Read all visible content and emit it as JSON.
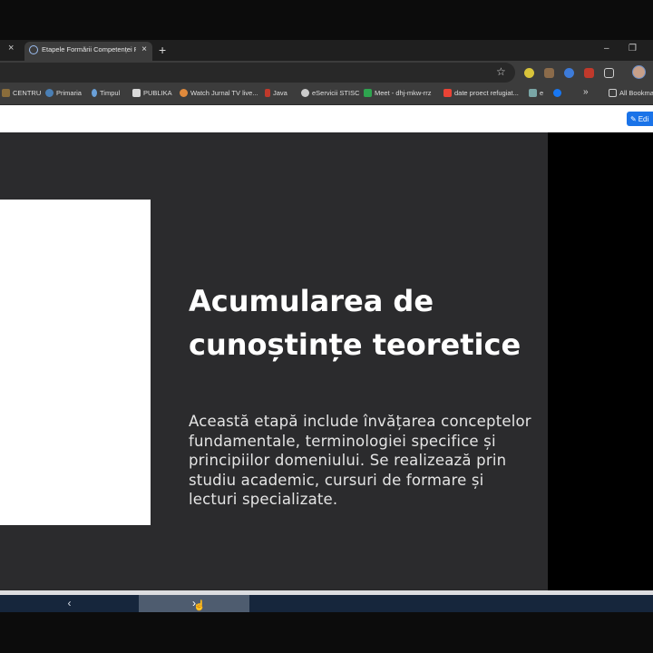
{
  "browser": {
    "active_tab_title": "Etapele Formării Competenței P",
    "close_glyph": "×",
    "new_tab_glyph": "+",
    "window_controls": [
      "–",
      "❐",
      "×"
    ],
    "bookmarks": [
      {
        "label": "CENTRU",
        "icon": "bookmark-folder-icon",
        "color": "#8a6d3b"
      },
      {
        "label": "Primaria",
        "icon": "wordpress-icon",
        "color": "#4a7fb5"
      },
      {
        "label": "Timpul",
        "icon": "timpul-icon",
        "color": "#6aa0d8"
      },
      {
        "label": "PUBLIKA",
        "icon": "publika-icon",
        "color": "#d9d9d9"
      },
      {
        "label": "Watch Jurnal TV live...",
        "icon": "jurnal-tv-icon",
        "color": "#e08a3c"
      },
      {
        "label": "Java",
        "icon": "java-icon",
        "color": "#c0392b"
      },
      {
        "label": "eServicii STISC",
        "icon": "eservicii-icon",
        "color": "#cccccc"
      },
      {
        "label": "Meet - dhj-mkw-rrz",
        "icon": "google-meet-icon",
        "color": "#2ea44f"
      },
      {
        "label": "date proect refugiat...",
        "icon": "gmail-icon",
        "color": "#ea4335"
      },
      {
        "label": "e",
        "icon": "bookmark-e-icon",
        "color": "#7aa6a6"
      },
      {
        "label": "",
        "icon": "facebook-icon",
        "color": "#1877f2"
      }
    ],
    "more_glyph": "»",
    "all_bookmarks_label": "All Bookma"
  },
  "page": {
    "edit_button_label": "Edi",
    "slide_title": "Acumularea de cunoștințe teoretice",
    "slide_body": "Această etapă include învățarea conceptelor fundamentale, terminologiei specifice și principiilor domeniului. Se realizează prin studiu academic, cursuri de formare și lecturi specializate.",
    "nav_prev_glyph": "‹",
    "nav_next_glyph": "›"
  },
  "colors": {
    "slide_bg": "#2b2b2d",
    "nav_bg": "#16263c",
    "nav_active": "#4e5c6f",
    "edit_button": "#1a73e8"
  }
}
